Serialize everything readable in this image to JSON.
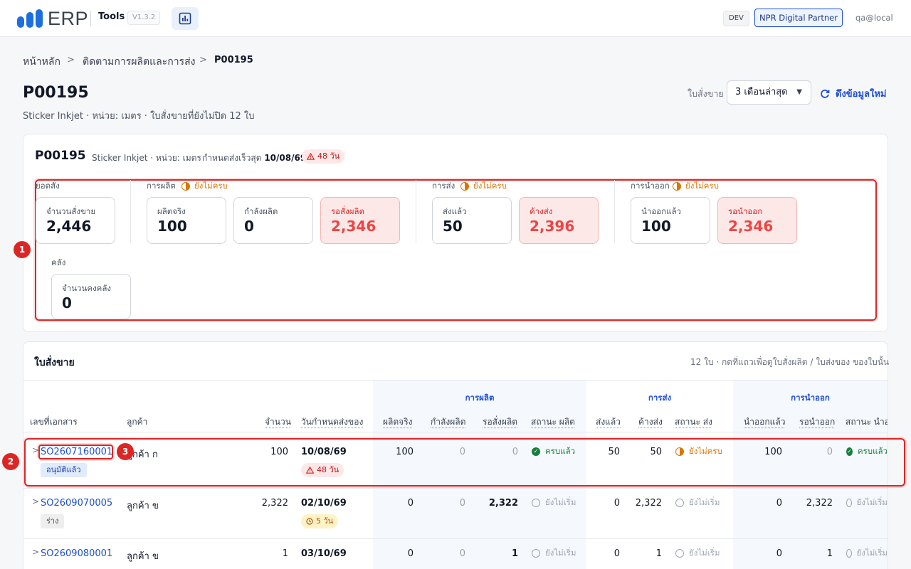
{
  "app": {
    "name": "ERP",
    "module": "Tools",
    "version": "V1.3.2",
    "env": "DEV",
    "partner": "NPR Digital Partner",
    "user": "qa@local"
  },
  "breadcrumb": {
    "home": "หน้าหลัก",
    "section": "ติดตามการผลิตและการส่ง",
    "current": "P00195"
  },
  "page": {
    "title": "P00195",
    "subtitle": "Sticker Inkjet · หน่วย: เมตร · ใบสั่งขายที่ยังไม่ปิด 12 ใบ",
    "filter_label": "ใบสั่งขาย",
    "filter_value": "3 เดือนล่าสุด",
    "refresh_label": "ดึงข้อมูลใหม่"
  },
  "summary": {
    "code": "P00195",
    "meta": "Sticker Inkjet · หน่วย: เมตร",
    "due_label": "กำหนดส่งเร็วสุด",
    "due_date": "10/08/69",
    "late": "48 วัน",
    "order_group": "ยอดสั่ง",
    "order_qty_label": "จำนวนสั่งขาย",
    "order_qty": "2,446",
    "production": {
      "label": "การผลิต",
      "status": "ยังไม่ครบ",
      "actual_label": "ผลิตจริง",
      "actual": "100",
      "in_progress_label": "กำลังผลิต",
      "in_progress": "0",
      "pending_label": "รอสั่งผลิต",
      "pending": "2,346"
    },
    "shipping": {
      "label": "การส่ง",
      "status": "ยังไม่ครบ",
      "sent_label": "ส่งแล้ว",
      "sent": "50",
      "remaining_label": "ค้างส่ง",
      "remaining": "2,396"
    },
    "export": {
      "label": "การนำออก",
      "status": "ยังไม่ครบ",
      "out_label": "นำออกแล้ว",
      "out": "100",
      "pending_label": "รอนำออก",
      "pending": "2,346"
    },
    "stock": {
      "label": "คลัง",
      "qty_label": "จำนวนคงคลัง",
      "qty": "0"
    }
  },
  "markers": [
    "1",
    "2",
    "3"
  ],
  "orders": {
    "title": "ใบสั่งขาย",
    "hint": "12 ใบ · กดที่แถวเพื่อดูใบสั่งผลิต / ใบส่งของ ของใบนั้น",
    "groups": {
      "production": "การผลิต",
      "shipping": "การส่ง",
      "export": "การนำออก"
    },
    "columns": {
      "doc": "เลขที่เอกสาร",
      "customer": "ลูกค้า",
      "qty": "จำนวน",
      "due": "วันกำหนดส่งของ",
      "actual": "ผลิตจริง",
      "in_progress": "กำลังผลิต",
      "pending": "รอสั่งผลิต",
      "prod_status": "สถานะ ผลิต",
      "sent": "ส่งแล้ว",
      "remaining": "ค้างส่ง",
      "ship_status": "สถานะ ส่ง",
      "out": "นำออกแล้ว",
      "out_pending": "รอนำออก",
      "out_status": "สถานะ นำออ"
    },
    "rows": [
      {
        "doc": "SO2607160001",
        "tag": "อนุมัติแล้ว",
        "customer": "ลูกค้า ก",
        "qty": "100",
        "due": "10/08/69",
        "due_badge": "48 วัน",
        "actual": "100",
        "in_progress": "0",
        "pending": "0",
        "prod_status": "ครบแล้ว",
        "sent": "50",
        "remaining": "50",
        "ship_status": "ยังไม่ครบ",
        "out": "100",
        "out_pending": "0",
        "out_status": "ครบแล้ว"
      },
      {
        "doc": "SO2609070005",
        "tag": "ร่าง",
        "customer": "ลูกค้า ข",
        "qty": "2,322",
        "due": "02/10/69",
        "due_badge": "5 วัน",
        "actual": "0",
        "in_progress": "0",
        "pending": "2,322",
        "prod_status": "ยังไม่เริ่ม",
        "sent": "0",
        "remaining": "2,322",
        "ship_status": "ยังไม่เริ่ม",
        "out": "0",
        "out_pending": "2,322",
        "out_status": "ยังไม่เริ่ม"
      },
      {
        "doc": "SO2609080001",
        "tag": "",
        "customer": "ลูกค้า ข",
        "qty": "1",
        "due": "03/10/69",
        "due_badge": "",
        "actual": "0",
        "in_progress": "0",
        "pending": "1",
        "prod_status": "ยังไม่เริ่ม",
        "sent": "0",
        "remaining": "1",
        "ship_status": "ยังไม่เริ่ม",
        "out": "0",
        "out_pending": "1",
        "out_status": "ยังไม่เริ่ม"
      }
    ]
  }
}
